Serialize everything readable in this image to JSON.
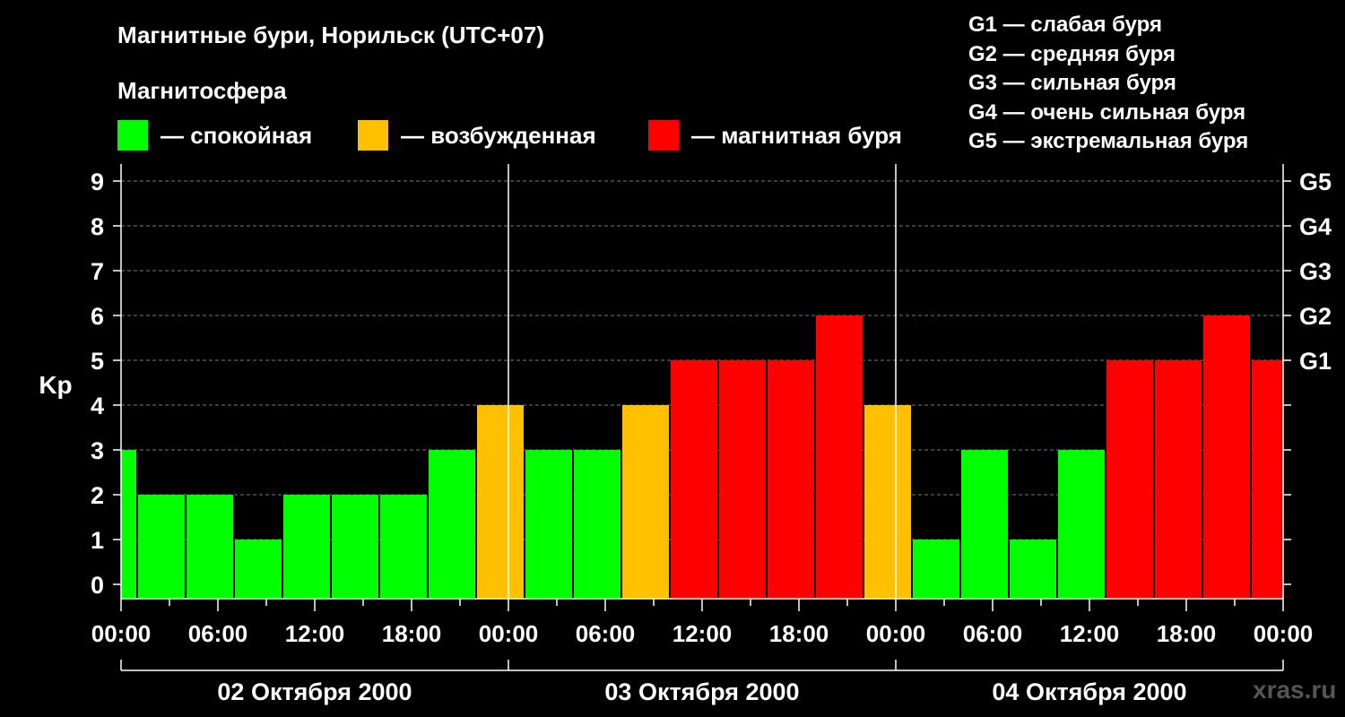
{
  "title": "Магнитные бури, Норильск (UTC+07)",
  "legend_title": "Магнитосфера",
  "legend": [
    {
      "label": "— спокойная",
      "color": "#00ff00"
    },
    {
      "label": "— возбужденная",
      "color": "#ffc000"
    },
    {
      "label": "— магнитная буря",
      "color": "#ff0000"
    }
  ],
  "g_scale": [
    "G1 — слабая буря",
    "G2 — средняя буря",
    "G3 — сильная буря",
    "G4 — очень сильная буря",
    "G5 — экстремальная буря"
  ],
  "watermark": "xras.ru",
  "chart_data": {
    "type": "bar",
    "ylabel": "Kp",
    "ylim": [
      0,
      9
    ],
    "y_ticks": [
      0,
      1,
      2,
      3,
      4,
      5,
      6,
      7,
      8,
      9
    ],
    "g_ticks": [
      {
        "label": "G1",
        "kp": 5
      },
      {
        "label": "G2",
        "kp": 6
      },
      {
        "label": "G3",
        "kp": 7
      },
      {
        "label": "G4",
        "kp": 8
      },
      {
        "label": "G5",
        "kp": 9
      }
    ],
    "x_ticks": [
      "00:00",
      "06:00",
      "12:00",
      "18:00",
      "00:00",
      "06:00",
      "12:00",
      "18:00",
      "00:00",
      "06:00",
      "12:00",
      "18:00",
      "00:00"
    ],
    "dates": [
      "02 Октября 2000",
      "03 Октября 2000",
      "04 Октября 2000"
    ],
    "bar_start_hours": [
      -2,
      1,
      4,
      7,
      10,
      13,
      16,
      19,
      22,
      25,
      28,
      31,
      34,
      37,
      40,
      43,
      46,
      49,
      52,
      55,
      58,
      61,
      64,
      67,
      70
    ],
    "values": [
      3,
      2,
      2,
      1,
      2,
      2,
      2,
      3,
      4,
      3,
      3,
      4,
      5,
      5,
      5,
      6,
      4,
      1,
      3,
      1,
      3,
      5,
      5,
      6,
      5
    ],
    "grid": true,
    "colors": {
      "quiet": "#00ff00",
      "active": "#ffc000",
      "storm": "#ff0000"
    }
  }
}
